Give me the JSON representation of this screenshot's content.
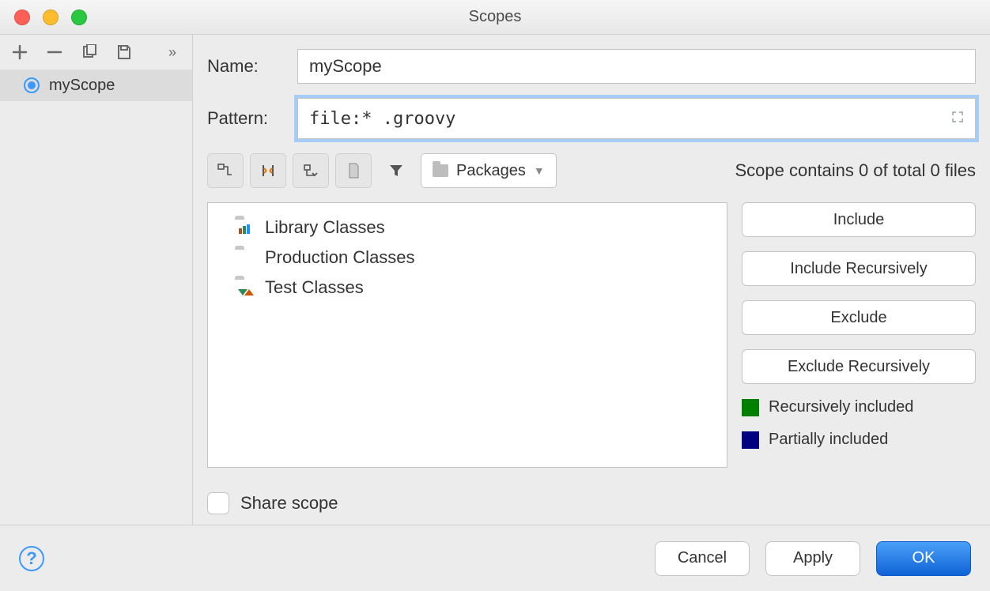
{
  "window": {
    "title": "Scopes"
  },
  "sidebar": {
    "items": [
      {
        "label": "myScope"
      }
    ]
  },
  "form": {
    "name_label": "Name:",
    "name_value": "myScope",
    "pattern_label": "Pattern:",
    "pattern_value": "file:* .groovy"
  },
  "toolbar": {
    "packages_label": "Packages"
  },
  "status": {
    "text": "Scope contains 0 of total 0 files"
  },
  "tree": {
    "items": [
      {
        "label": "Library Classes",
        "kind": "lib"
      },
      {
        "label": "Production Classes",
        "kind": "prod"
      },
      {
        "label": "Test Classes",
        "kind": "test"
      }
    ]
  },
  "actions": {
    "include": "Include",
    "include_rec": "Include Recursively",
    "exclude": "Exclude",
    "exclude_rec": "Exclude Recursively"
  },
  "legend": {
    "recursive": "Recursively included",
    "recursive_color": "#008000",
    "partial": "Partially included",
    "partial_color": "#000080"
  },
  "share": {
    "label": "Share scope",
    "checked": false
  },
  "footer": {
    "cancel": "Cancel",
    "apply": "Apply",
    "ok": "OK"
  }
}
